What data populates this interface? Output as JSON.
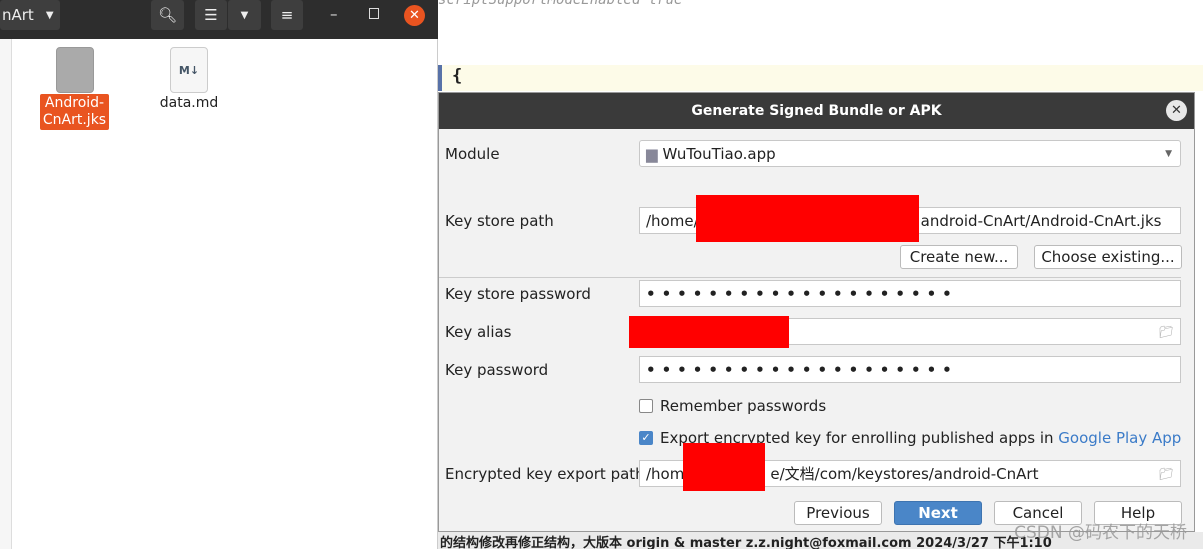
{
  "editor": {
    "code_line": "scriptSupportModeEnabled true",
    "brace": "{"
  },
  "file_manager": {
    "path_label": "nArt",
    "files": [
      {
        "name": "Android-CnArt.jks",
        "selected": true
      },
      {
        "name": "data.md"
      }
    ],
    "md_icon": "M↓"
  },
  "dialog": {
    "title": "Generate Signed Bundle or APK",
    "module_label": "Module",
    "module_value": "WuTouTiao.app",
    "keystore_path_label": "Key store path",
    "keystore_path_prefix": "/home/",
    "keystore_path_suffix": "android-CnArt/Android-CnArt.jks",
    "create_new": "Create new...",
    "choose_existing": "Choose existing...",
    "keystore_password_label": "Key store password",
    "keystore_password": "••••••••••••••••••••",
    "key_alias_label": "Key alias",
    "key_password_label": "Key password",
    "key_password": "••••••••••••••••••••",
    "remember_label": "Remember passwords",
    "remember_checked": false,
    "export_label": "Export encrypted key for enrolling published apps in ",
    "export_link": "Google Play App Signing",
    "export_checked": true,
    "export_path_label": "Encrypted key export path",
    "export_path_prefix": "/hom",
    "export_path_suffix": "e/文档/com/keystores/android-CnArt",
    "previous": "Previous",
    "next": "Next",
    "cancel": "Cancel",
    "help": "Help"
  },
  "bottom_bar": {
    "text": "的结构修改再修正结构，大版本  origin & master  z.z.night@foxmail.com  2024/3/27 下午1:10"
  },
  "watermark": "CSDN @码农下的天桥",
  "colors": {
    "accent": "#4a86c8",
    "selected": "#e95420",
    "link": "#3b7bc8"
  }
}
